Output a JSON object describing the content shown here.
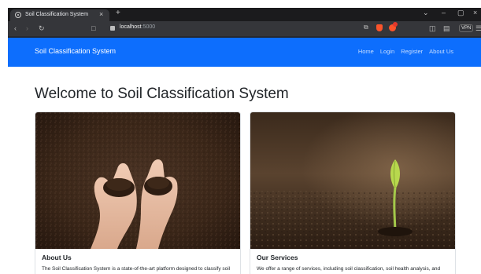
{
  "browser": {
    "tab_title": "Soil Classification System",
    "tab_close": "×",
    "new_tab": "+",
    "window_controls": [
      "⌄",
      "–",
      "▢",
      "×"
    ],
    "url_host": "localhost",
    "url_port": ":5000",
    "vpn_label": "VPN",
    "icons": [
      "back-icon",
      "forward-icon",
      "reload-icon",
      "bookmark-icon",
      "lock-icon",
      "share-icon",
      "brave-shield-icon",
      "brave-rewards-icon",
      "sidebar-icon",
      "wallet-icon",
      "menu-icon"
    ]
  },
  "navbar": {
    "brand": "Soil Classification System",
    "links": [
      "Home",
      "Login",
      "Register",
      "About Us"
    ],
    "background": "#0d6efd"
  },
  "main": {
    "heading": "Welcome to Soil Classification System",
    "cards": [
      {
        "title": "About Us",
        "text": "The Soil Classification System is a state-of-the-art platform designed to classify soil types using advanced image processing and machine"
      },
      {
        "title": "Our Services",
        "text": "We offer a range of services, including soil classification, soil health analysis, and agricultural recommendations. Our platform allows users to"
      }
    ]
  }
}
